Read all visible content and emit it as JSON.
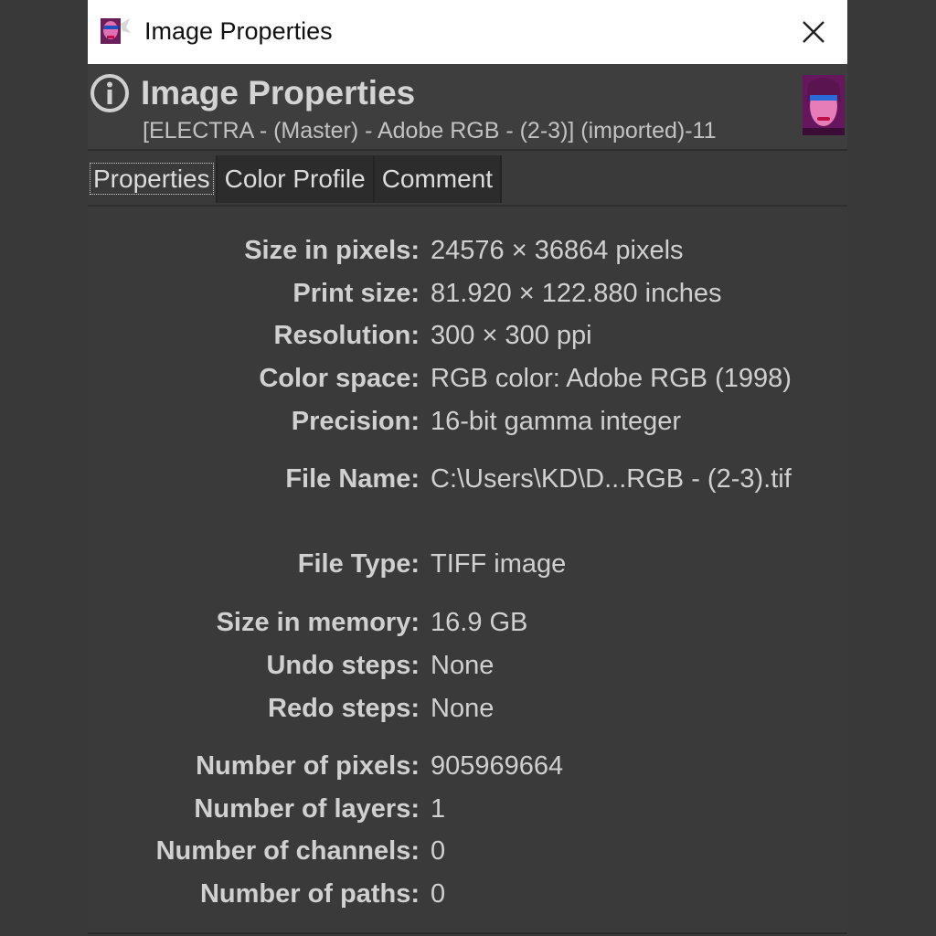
{
  "window": {
    "title": "Image Properties",
    "close_icon": "close-x-icon",
    "app_icon": "gimp-image-icon"
  },
  "header": {
    "icon": "info-icon",
    "title": "Image Properties",
    "subtitle": "[ELECTRA - (Master) - Adobe RGB - (2-3)] (imported)-11",
    "thumbnail": "image-thumbnail"
  },
  "tabs": [
    {
      "label": "Properties",
      "active": true
    },
    {
      "label": "Color Profile",
      "active": false
    },
    {
      "label": "Comment",
      "active": false
    }
  ],
  "properties": [
    {
      "label": "Size in pixels:",
      "value": "24576 × 36864 pixels"
    },
    {
      "label": "Print size:",
      "value": "81.920 × 122.880 inches"
    },
    {
      "label": "Resolution:",
      "value": "300 × 300 ppi"
    },
    {
      "label": "Color space:",
      "value": "RGB color: Adobe RGB (1998)"
    },
    {
      "label": "Precision:",
      "value": "16-bit gamma integer"
    },
    {
      "label": "File Name:",
      "value": "C:\\Users\\KD\\D...RGB - (2-3).tif"
    },
    {
      "label": "File Type:",
      "value": "TIFF image"
    },
    {
      "label": "Size in memory:",
      "value": "16.9 GB"
    },
    {
      "label": "Undo steps:",
      "value": "None"
    },
    {
      "label": "Redo steps:",
      "value": "None"
    },
    {
      "label": "Number of pixels:",
      "value": "905969664"
    },
    {
      "label": "Number of layers:",
      "value": "1"
    },
    {
      "label": "Number of channels:",
      "value": "0"
    },
    {
      "label": "Number of paths:",
      "value": "0"
    }
  ],
  "colors": {
    "background": "#393939",
    "text": "#d0d0d0",
    "titlebar": "#ffffff",
    "tab_inactive": "#2c2c2c"
  }
}
